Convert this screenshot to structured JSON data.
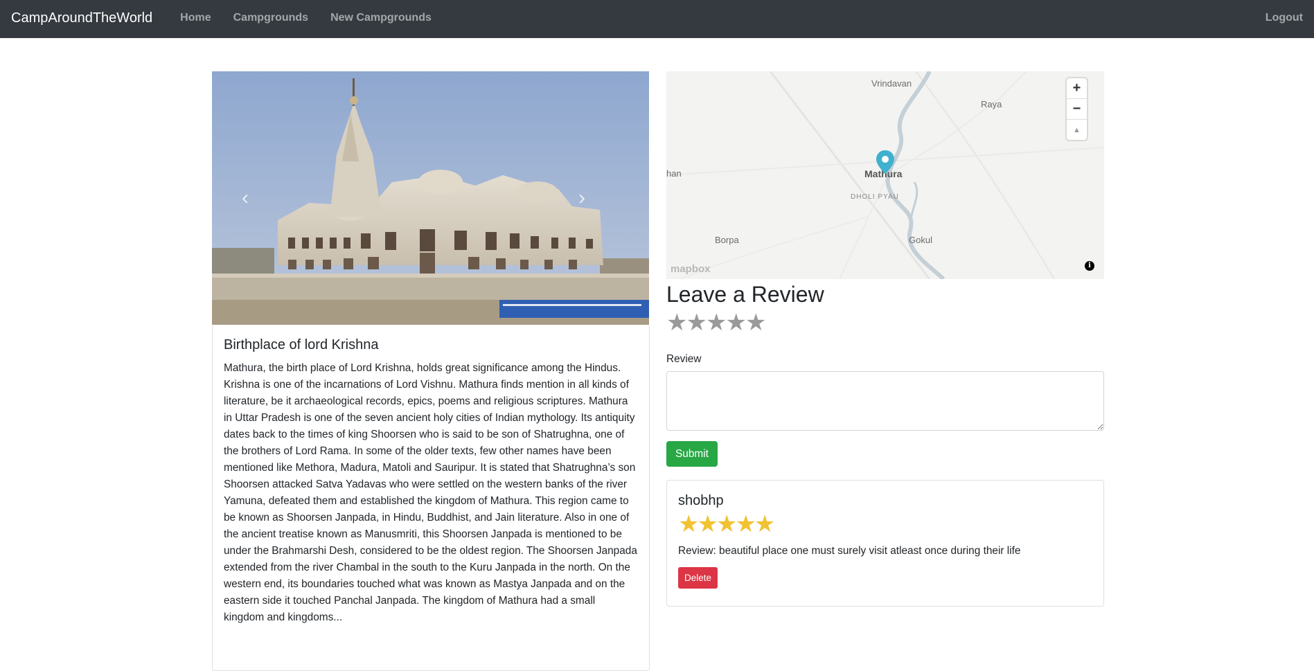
{
  "navbar": {
    "brand": "CampAroundTheWorld",
    "links": [
      "Home",
      "Campgrounds",
      "New Campgrounds"
    ],
    "logout": "Logout"
  },
  "carousel": {
    "prev_icon": "chevron-left-icon",
    "next_icon": "chevron-right-icon"
  },
  "campground": {
    "title": "Birthplace of lord Krishna",
    "description": "Mathura, the birth place of Lord Krishna, holds great significance among the Hindus. Krishna is one of the incarnations of Lord Vishnu. Mathura finds mention in all kinds of literature, be it archaeological records, epics, poems and religious scriptures. Mathura in Uttar Pradesh is one of the seven ancient holy cities of Indian mythology. Its antiquity dates back to the times of king Shoorsen who is said to be son of Shatrughna, one of the brothers of Lord Rama. In some of the older texts, few other names have been mentioned like Methora, Madura, Matoli and Sauripur. It is stated that Shatrughna’s son Shoorsen attacked Satva Yadavas who were settled on the western banks of the river Yamuna, defeated them and established the kingdom of Mathura. This region came to be known as Shoorsen Janpada, in Hindu, Buddhist, and Jain literature. Also in one of the ancient treatise known as Manusmriti, this Shoorsen Janpada is mentioned to be under the Brahmarshi Desh, considered to be the oldest region. The Shoorsen Janpada extended from the river Chambal in the south to the Kuru Janpada in the north. On the western end, its boundaries touched what was known as Mastya Janpada and on the eastern side it touched Panchal Janpada. The kingdom of Mathura had a small kingdom and kingdoms..."
  },
  "map": {
    "labels": {
      "vrindavan": "Vrindavan",
      "raya": "Raya",
      "han": "han",
      "mathura": "Mathura",
      "dholi": "DHOLI PYAU",
      "borpa": "Borpa",
      "gokul": "Gokul"
    },
    "zoom_in": "+",
    "zoom_out": "−",
    "compass": "▲",
    "logo": "mapbox",
    "info": "i",
    "marker_color": "#3fb1ce"
  },
  "review_form": {
    "heading": "Leave a Review",
    "stars": [
      "★",
      "★",
      "★",
      "★",
      "★"
    ],
    "label": "Review",
    "submit": "Submit"
  },
  "reviews": [
    {
      "author": "shobhp",
      "stars": "★★★★★",
      "text": "Review: beautiful place one must surely visit atleast once during their life",
      "delete": "Delete"
    }
  ]
}
